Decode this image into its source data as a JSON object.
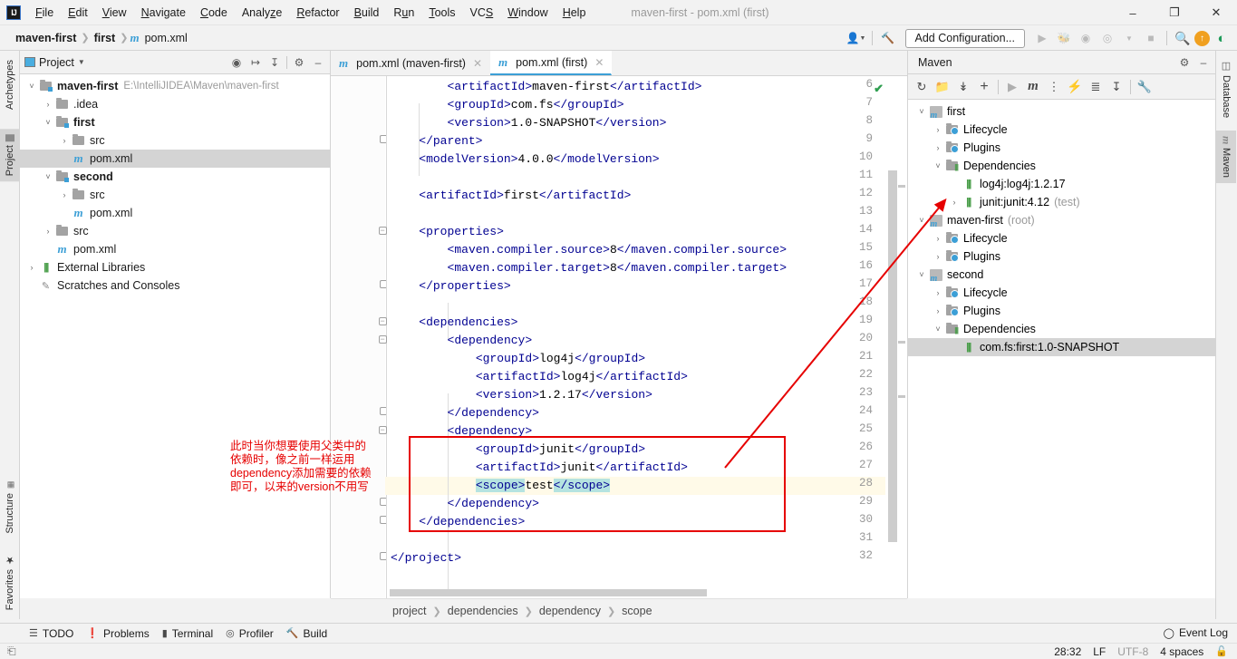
{
  "window": {
    "title": "maven-first - pom.xml (first)",
    "logo": "intellij-idea-logo",
    "minimize": "–",
    "maximize": "❐",
    "close": "✕"
  },
  "menubar": {
    "items": [
      {
        "label": "File"
      },
      {
        "label": "Edit"
      },
      {
        "label": "View"
      },
      {
        "label": "Navigate"
      },
      {
        "label": "Code"
      },
      {
        "label": "Analyze"
      },
      {
        "label": "Refactor"
      },
      {
        "label": "Build"
      },
      {
        "label": "Run"
      },
      {
        "label": "Tools"
      },
      {
        "label": "VCS"
      },
      {
        "label": "Window"
      },
      {
        "label": "Help"
      }
    ]
  },
  "navbar": {
    "breadcrumb": [
      "maven-first",
      "first",
      "pom.xml"
    ],
    "file_icon": "m",
    "add_configuration": "Add Configuration...",
    "icons": [
      "user-avatar-icon",
      "hammer-build-icon",
      "run-icon",
      "debug-icon",
      "run-coverage-icon",
      "profile-icon",
      "stop-icon",
      "search-icon",
      "update-project-icon",
      "idea-indicator-icon"
    ]
  },
  "left_strip": {
    "top_tabs": [
      {
        "label": "Archetypes",
        "active": false
      },
      {
        "label": "Project",
        "active": true
      }
    ],
    "bottom_tabs": [
      {
        "label": "Structure",
        "active": false
      },
      {
        "label": "Favorites",
        "active": false
      }
    ]
  },
  "right_strip": {
    "tabs": [
      {
        "label": "Database",
        "active": false
      },
      {
        "label": "Maven",
        "active": true
      }
    ]
  },
  "project_panel": {
    "title": "Project",
    "header_icons": [
      "locate-icon",
      "expand-all-icon",
      "collapse-all-icon",
      "settings-gear-icon",
      "hide-icon"
    ],
    "tree": [
      {
        "indent": 0,
        "arrow": "˅",
        "icon": "module-folder",
        "label": "maven-first",
        "bold": true,
        "path": "E:\\IntelliJIDEA\\Maven\\maven-first",
        "selected": false
      },
      {
        "indent": 1,
        "arrow": "›",
        "icon": "folder",
        "label": ".idea",
        "bold": false,
        "path": "",
        "selected": false
      },
      {
        "indent": 1,
        "arrow": "˅",
        "icon": "module-folder",
        "label": "first",
        "bold": true,
        "path": "",
        "selected": false
      },
      {
        "indent": 2,
        "arrow": "›",
        "icon": "folder",
        "label": "src",
        "bold": false,
        "path": "",
        "selected": false
      },
      {
        "indent": 2,
        "arrow": "",
        "icon": "maven-file",
        "label": "pom.xml",
        "bold": false,
        "path": "",
        "selected": true
      },
      {
        "indent": 1,
        "arrow": "˅",
        "icon": "module-folder",
        "label": "second",
        "bold": true,
        "path": "",
        "selected": false
      },
      {
        "indent": 2,
        "arrow": "›",
        "icon": "folder",
        "label": "src",
        "bold": false,
        "path": "",
        "selected": false
      },
      {
        "indent": 2,
        "arrow": "",
        "icon": "maven-file",
        "label": "pom.xml",
        "bold": false,
        "path": "",
        "selected": false
      },
      {
        "indent": 1,
        "arrow": "›",
        "icon": "folder",
        "label": "src",
        "bold": false,
        "path": "",
        "selected": false
      },
      {
        "indent": 1,
        "arrow": "",
        "icon": "maven-file",
        "label": "pom.xml",
        "bold": false,
        "path": "",
        "selected": false
      },
      {
        "indent": 0,
        "arrow": "›",
        "icon": "library",
        "label": "External Libraries",
        "bold": false,
        "path": "",
        "selected": false
      },
      {
        "indent": 0,
        "arrow": "",
        "icon": "scratches",
        "label": "Scratches and Consoles",
        "bold": false,
        "path": "",
        "selected": false
      }
    ]
  },
  "editor": {
    "tabs": [
      {
        "label": "pom.xml (maven-first)",
        "active": false,
        "icon": "m"
      },
      {
        "label": "pom.xml (first)",
        "active": true,
        "icon": "m"
      }
    ],
    "first_line_number": 6,
    "lines": [
      {
        "n": 6,
        "indent": 8,
        "text": "<artifactId>maven-first</artifactId>",
        "fold": ""
      },
      {
        "n": 7,
        "indent": 8,
        "text": "<groupId>com.fs</groupId>",
        "fold": ""
      },
      {
        "n": 8,
        "indent": 8,
        "text": "<version>1.0-SNAPSHOT</version>",
        "fold": ""
      },
      {
        "n": 9,
        "indent": 4,
        "text": "</parent>",
        "fold": "end"
      },
      {
        "n": 10,
        "indent": 4,
        "text": "<modelVersion>4.0.0</modelVersion>",
        "fold": ""
      },
      {
        "n": 11,
        "indent": 0,
        "text": "",
        "fold": ""
      },
      {
        "n": 12,
        "indent": 4,
        "text": "<artifactId>first</artifactId>",
        "fold": ""
      },
      {
        "n": 13,
        "indent": 0,
        "text": "",
        "fold": ""
      },
      {
        "n": 14,
        "indent": 4,
        "text": "<properties>",
        "fold": "start"
      },
      {
        "n": 15,
        "indent": 8,
        "text": "<maven.compiler.source>8</maven.compiler.source>",
        "fold": ""
      },
      {
        "n": 16,
        "indent": 8,
        "text": "<maven.compiler.target>8</maven.compiler.target>",
        "fold": ""
      },
      {
        "n": 17,
        "indent": 4,
        "text": "</properties>",
        "fold": "end"
      },
      {
        "n": 18,
        "indent": 0,
        "text": "",
        "fold": ""
      },
      {
        "n": 19,
        "indent": 4,
        "text": "<dependencies>",
        "fold": "start"
      },
      {
        "n": 20,
        "indent": 8,
        "text": "<dependency>",
        "fold": "start"
      },
      {
        "n": 21,
        "indent": 12,
        "text": "<groupId>log4j</groupId>",
        "fold": ""
      },
      {
        "n": 22,
        "indent": 12,
        "text": "<artifactId>log4j</artifactId>",
        "fold": ""
      },
      {
        "n": 23,
        "indent": 12,
        "text": "<version>1.2.17</version>",
        "fold": ""
      },
      {
        "n": 24,
        "indent": 8,
        "text": "</dependency>",
        "fold": "end"
      },
      {
        "n": 25,
        "indent": 8,
        "text": "<dependency>",
        "fold": "start"
      },
      {
        "n": 26,
        "indent": 12,
        "text": "<groupId>junit</groupId>",
        "fold": ""
      },
      {
        "n": 27,
        "indent": 12,
        "text": "<artifactId>junit</artifactId>",
        "fold": ""
      },
      {
        "n": 28,
        "indent": 12,
        "text": "<scope>test</scope>",
        "fold": "",
        "caret": true,
        "selected": true
      },
      {
        "n": 29,
        "indent": 8,
        "text": "</dependency>",
        "fold": "end"
      },
      {
        "n": 30,
        "indent": 4,
        "text": "</dependencies>",
        "fold": "end"
      },
      {
        "n": 31,
        "indent": 0,
        "text": "",
        "fold": ""
      },
      {
        "n": 32,
        "indent": 0,
        "text": "</project>",
        "fold": "end"
      }
    ],
    "inspection_status": "no-errors-check-icon",
    "breadcrumbs": [
      "project",
      "dependencies",
      "dependency",
      "scope"
    ]
  },
  "maven_panel": {
    "title": "Maven",
    "header_icons": [
      "settings-gear-icon",
      "hide-icon"
    ],
    "toolbar_icons": [
      "reload-all-projects-icon",
      "generate-sources-icon",
      "download-sources-icon",
      "add-maven-project-icon",
      "run-maven-build-icon",
      "execute-maven-goal-icon",
      "toggle-skip-tests-icon",
      "toggle-offline-mode-icon",
      "show-dependencies-icon",
      "collapse-all-icon",
      "maven-settings-icon"
    ],
    "tree": [
      {
        "indent": 0,
        "arrow": "˅",
        "icon": "maven-module",
        "label": "first",
        "suffix": "",
        "selected": false
      },
      {
        "indent": 1,
        "arrow": "›",
        "icon": "lifecycle-folder",
        "label": "Lifecycle",
        "suffix": "",
        "selected": false
      },
      {
        "indent": 1,
        "arrow": "›",
        "icon": "plugins-folder",
        "label": "Plugins",
        "suffix": "",
        "selected": false
      },
      {
        "indent": 1,
        "arrow": "˅",
        "icon": "dependencies-folder",
        "label": "Dependencies",
        "suffix": "",
        "selected": false
      },
      {
        "indent": 2,
        "arrow": "",
        "icon": "library",
        "label": "log4j:log4j:1.2.17",
        "suffix": "",
        "selected": false
      },
      {
        "indent": 2,
        "arrow": "›",
        "icon": "library",
        "label": "junit:junit:4.12",
        "suffix": "(test)",
        "selected": false
      },
      {
        "indent": 0,
        "arrow": "˅",
        "icon": "maven-module",
        "label": "maven-first",
        "suffix": "(root)",
        "selected": false
      },
      {
        "indent": 1,
        "arrow": "›",
        "icon": "lifecycle-folder",
        "label": "Lifecycle",
        "suffix": "",
        "selected": false
      },
      {
        "indent": 1,
        "arrow": "›",
        "icon": "plugins-folder",
        "label": "Plugins",
        "suffix": "",
        "selected": false
      },
      {
        "indent": 0,
        "arrow": "˅",
        "icon": "maven-module",
        "label": "second",
        "suffix": "",
        "selected": false
      },
      {
        "indent": 1,
        "arrow": "›",
        "icon": "lifecycle-folder",
        "label": "Lifecycle",
        "suffix": "",
        "selected": false
      },
      {
        "indent": 1,
        "arrow": "›",
        "icon": "plugins-folder",
        "label": "Plugins",
        "suffix": "",
        "selected": false
      },
      {
        "indent": 1,
        "arrow": "˅",
        "icon": "dependencies-folder",
        "label": "Dependencies",
        "suffix": "",
        "selected": false
      },
      {
        "indent": 2,
        "arrow": "",
        "icon": "library",
        "label": "com.fs:first:1.0-SNAPSHOT",
        "suffix": "",
        "selected": true
      }
    ]
  },
  "bottom_bar": {
    "items": [
      {
        "label": "TODO",
        "icon": "todo-list-icon"
      },
      {
        "label": "Problems",
        "icon": "problems-icon"
      },
      {
        "label": "Terminal",
        "icon": "terminal-icon"
      },
      {
        "label": "Profiler",
        "icon": "profiler-icon"
      },
      {
        "label": "Build",
        "icon": "build-hammer-icon"
      }
    ],
    "event_log": "Event Log"
  },
  "statusbar": {
    "caret_position": "28:32",
    "line_separator": "LF",
    "encoding": "UTF-8",
    "indent": "4 spaces",
    "lock": "unlocked-icon"
  },
  "annotations": {
    "note_text": "此时当你想要使用父类中的\n依赖时，像之前一样运用\ndependency添加需要的依赖\n即可，以来的version不用写",
    "box_color": "#e60000",
    "arrow_color": "#e60000"
  }
}
